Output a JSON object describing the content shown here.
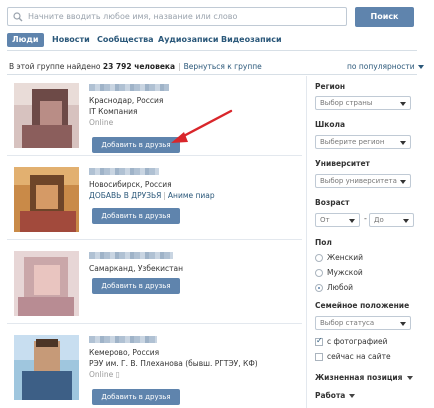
{
  "search": {
    "placeholder": "Начните вводить любое имя, название или слово",
    "button_label": "Поиск"
  },
  "tabs": [
    {
      "label": "Люди",
      "active": true
    },
    {
      "label": "Новости"
    },
    {
      "label": "Сообщества"
    },
    {
      "label": "Аудиозаписи"
    },
    {
      "label": "Видеозаписи"
    }
  ],
  "summary": {
    "prefix": "В этой группе найдено",
    "count": "23 792 человека",
    "separator": "|",
    "back_link": "Вернуться к группе",
    "sort_label": "по популярности"
  },
  "results": [
    {
      "location": "Краснодар, Россия",
      "line2": "IT Компания",
      "online": "Online",
      "add_button": "Добавить в друзья"
    },
    {
      "location": "Новосибирск, Россия",
      "line2_link1": "ДОБАВЬ В ДРУЗЬЯ",
      "line2_sep": "|",
      "line2_link2": "Аниме пиар",
      "add_button": "Добавить в друзья"
    },
    {
      "location": "Самарканд, Узбекистан",
      "add_button": "Добавить в друзья"
    },
    {
      "location": "Кемерово, Россия",
      "line2": "РЭУ им. Г. В. Плеханова (бывш. РГТЭУ, КФ)",
      "online": "Online",
      "add_button": "Добавить в друзья"
    }
  ],
  "filters": {
    "region": {
      "title": "Регион",
      "value": "Выбор страны"
    },
    "school": {
      "title": "Школа",
      "value": "Выберите регион"
    },
    "university": {
      "title": "Университет",
      "value": "Выбор университета"
    },
    "age": {
      "title": "Возраст",
      "from": "От",
      "dash": "-",
      "to": "До"
    },
    "sex": {
      "title": "Пол",
      "options": [
        "Женский",
        "Мужской",
        "Любой"
      ],
      "selected": "Любой"
    },
    "marital": {
      "title": "Семейное положение",
      "value": "Выбор статуса"
    },
    "with_photo": {
      "label": "с фотографией",
      "checked": true
    },
    "online_now": {
      "label": "сейчас на сайте",
      "checked": false
    },
    "life_position": "Жизненная позиция",
    "work": "Работа"
  },
  "colors": {
    "accent": "#5f84ad",
    "link": "#2b587a",
    "annotation_arrow": "#d9262b"
  }
}
